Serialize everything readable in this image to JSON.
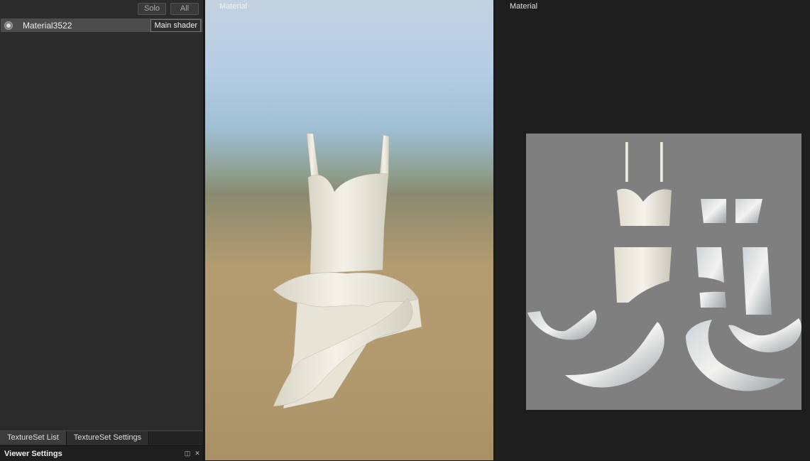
{
  "texture_panel": {
    "solo_label": "Solo",
    "all_label": "All",
    "material_name": "Material3522",
    "shader_label": "Main shader"
  },
  "tabs": [
    {
      "label": "TextureSet List"
    },
    {
      "label": "TextureSet Settings"
    }
  ],
  "viewer_settings": {
    "title": "Viewer Settings"
  },
  "viewport_3d": {
    "label": "Material"
  },
  "viewport_2d": {
    "label": "Material"
  },
  "colors": {
    "panel_bg": "#2b2b2b",
    "selected_row": "#4c4c4c",
    "uv_background": "#7f7f7f",
    "fabric": "#eeebdc"
  },
  "icons": [
    "radio-icon",
    "float-icon",
    "close-icon"
  ]
}
